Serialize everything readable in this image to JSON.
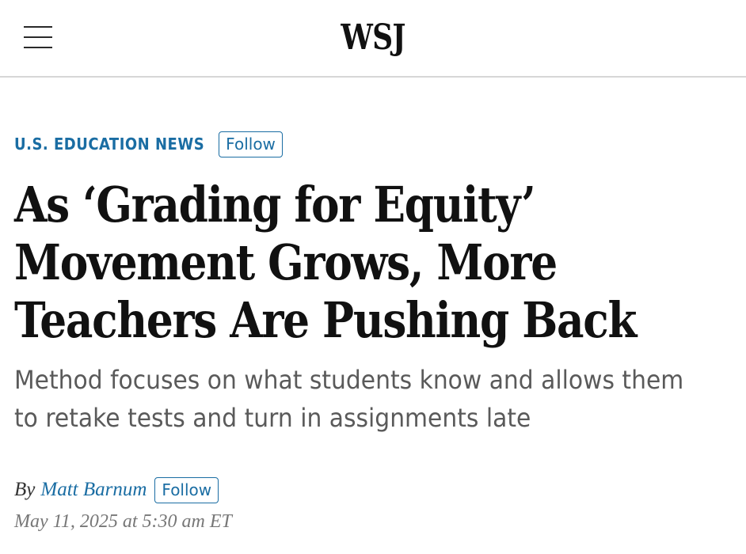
{
  "header": {
    "logo_text": "WSJ",
    "menu_icon": "hamburger-menu-icon"
  },
  "section": {
    "label": "U.S. EDUCATION NEWS",
    "follow_label": "Follow"
  },
  "article": {
    "headline_lines": [
      "As ‘Grading for Equity’",
      "Movement Grows, More",
      "Teachers Are Pushing Back"
    ],
    "dek_lines": [
      "Method focuses on what students know and allows them",
      "to retake tests and turn in assignments late"
    ]
  },
  "byline": {
    "prefix": "By",
    "author": "Matt Barnum",
    "follow_label": "Follow",
    "date": "May 11, 2025 at 5:30 am ET"
  },
  "colors": {
    "accent": "#1a6da3",
    "text": "#111111",
    "dek": "#5a5a5a",
    "date": "#777777",
    "divider": "#d6d6d6"
  }
}
